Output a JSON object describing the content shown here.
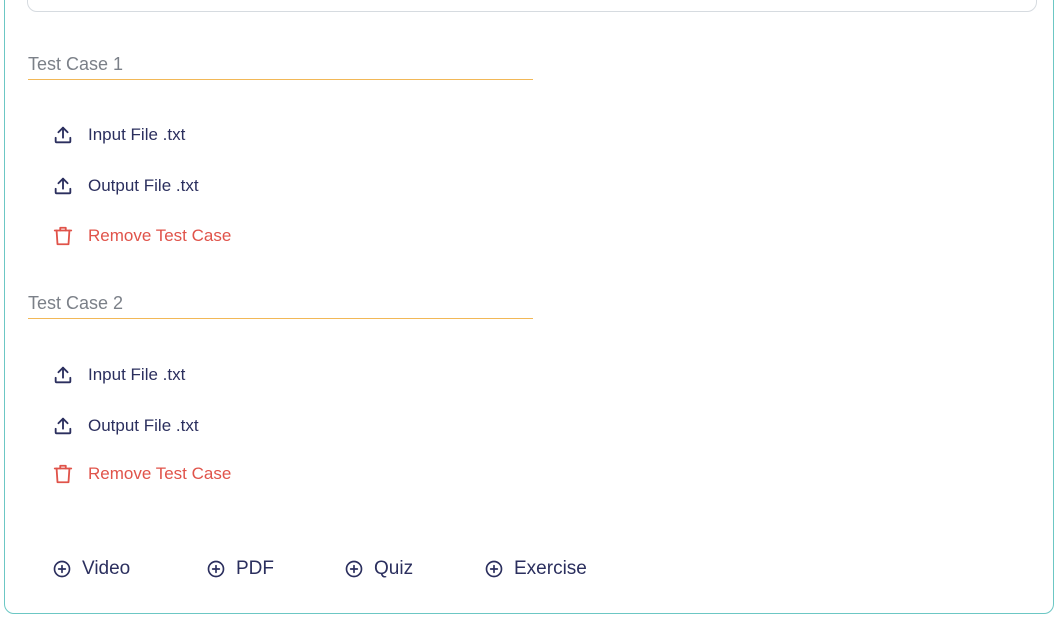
{
  "test_cases": [
    {
      "title": "Test Case 1",
      "input_label": "Input File .txt",
      "output_label": "Output File .txt",
      "remove_label": "Remove Test Case"
    },
    {
      "title": "Test Case 2",
      "input_label": "Input File .txt",
      "output_label": "Output File .txt",
      "remove_label": "Remove Test Case"
    }
  ],
  "add_buttons": {
    "video": "Video",
    "pdf": "PDF",
    "quiz": "Quiz",
    "exercise": "Exercise"
  },
  "icons": {
    "upload": "upload-icon",
    "trash": "trash-icon",
    "plus_circle": "plus-circle-icon"
  },
  "colors": {
    "navy": "#2b2f5e",
    "remove_red": "#e0534a",
    "header_underline": "#f2b857",
    "card_border": "#6cc7c4"
  }
}
